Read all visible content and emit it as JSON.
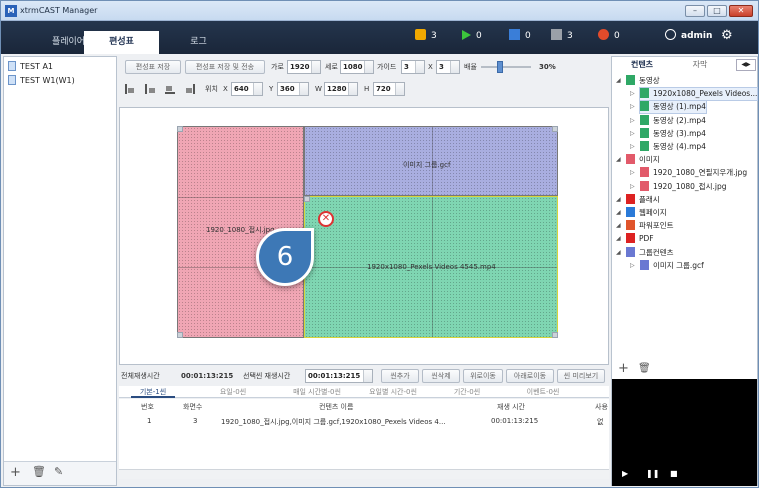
{
  "window": {
    "title": "xtrmCAST Manager",
    "logo": "M",
    "minimize": "–",
    "maximize": "□",
    "close": "✕"
  },
  "topbar": {
    "tabs": [
      {
        "label": "플레이어"
      },
      {
        "label": "편성표"
      },
      {
        "label": "로그"
      }
    ],
    "stats": [
      {
        "icon": "alert-icon",
        "value": "3",
        "color": "#f0a800"
      },
      {
        "icon": "play-icon",
        "value": "0",
        "color": "#3cc43c"
      },
      {
        "icon": "monitor-blue-icon",
        "value": "0",
        "color": "#3a7ed8"
      },
      {
        "icon": "monitor-gray-icon",
        "value": "3",
        "color": "#9aa0a8"
      },
      {
        "icon": "error-icon",
        "value": "0",
        "color": "#e24b2b"
      }
    ],
    "user": "admin",
    "user_icon": "account-icon",
    "settings_icon": "gear-icon"
  },
  "left": {
    "items": [
      {
        "label": "TEST A1"
      },
      {
        "label": "TEST W1(W1)"
      }
    ],
    "footer": {
      "add": "+",
      "delete": "🗑",
      "edit": "✎"
    }
  },
  "toolbar": {
    "save": "편성표 저장",
    "save_send": "편성표 저장 및 전송",
    "width_label": "가로",
    "width": "1920",
    "height_label": "세로",
    "height": "1080",
    "guide_label": "가이드",
    "guide_x": "3",
    "x_sep": "X",
    "guide_y": "3",
    "zoom_label": "배율",
    "zoom": "30%",
    "pos_label": "위치",
    "x_label": "X",
    "x": "640",
    "y_label": "Y",
    "y": "360",
    "w_label": "W",
    "w": "1280",
    "h_label": "H",
    "h": "720"
  },
  "canvas": {
    "zones": [
      {
        "label": "이미지 그룹.gcf"
      },
      {
        "label": "1920_1080_접시.jpg"
      },
      {
        "label": "1920x1080_Pexels Videos 4545.mp4"
      }
    ],
    "step": "6",
    "delete": "✕"
  },
  "playbar": {
    "total_label": "전체재생시간",
    "total": "00:01:13:215",
    "selected_label": "선택씬 재생시간",
    "selected": "00:01:13:215",
    "buttons": [
      "씬추가",
      "씬삭제",
      "위로이동",
      "아래로이동",
      "씬 미리보기"
    ]
  },
  "schedule_tabs": [
    "기본-1씬",
    "요일-0씬",
    "매일 시간별-0씬",
    "요일별 시간-0씬",
    "기간-0씬",
    "이벤트-0씬"
  ],
  "grid": {
    "headers": [
      "번호",
      "화면수",
      "컨텐츠 이름",
      "재생 시간",
      "사용"
    ],
    "rows": [
      {
        "no": "1",
        "screens": "3",
        "content": "1920_1080_접시.jpg,이미지 그룹.gcf,1920x1080_Pexels Videos 4...",
        "time": "00:01:13:215",
        "use": "없"
      }
    ]
  },
  "right": {
    "tabs": [
      "컨텐츠",
      "자막"
    ],
    "tree": [
      {
        "label": "동영상",
        "level": 0,
        "icon": "video-folder-icon"
      },
      {
        "label": "1920x1080_Pexels Videos...",
        "level": 1,
        "icon": "video-file-icon"
      },
      {
        "label": "동영상 (1).mp4",
        "level": 1,
        "icon": "video-file-icon"
      },
      {
        "label": "동영상 (2).mp4",
        "level": 1,
        "icon": "video-file-icon"
      },
      {
        "label": "동영상 (3).mp4",
        "level": 1,
        "icon": "video-file-icon"
      },
      {
        "label": "동영상 (4).mp4",
        "level": 1,
        "icon": "video-file-icon"
      },
      {
        "label": "이미지",
        "level": 0,
        "icon": "image-folder-icon"
      },
      {
        "label": "1920_1080_연필지우개.jpg",
        "level": 1,
        "icon": "image-file-icon"
      },
      {
        "label": "1920_1080_접시.jpg",
        "level": 1,
        "icon": "image-file-icon"
      },
      {
        "label": "플래시",
        "level": 0,
        "icon": "flash-icon"
      },
      {
        "label": "웹페이지",
        "level": 0,
        "icon": "web-icon"
      },
      {
        "label": "파워포인트",
        "level": 0,
        "icon": "powerpoint-icon"
      },
      {
        "label": "PDF",
        "level": 0,
        "icon": "pdf-icon"
      },
      {
        "label": "그룹컨텐츠",
        "level": 0,
        "icon": "group-folder-icon"
      },
      {
        "label": "이미지 그룹.gcf",
        "level": 1,
        "icon": "group-file-icon"
      }
    ],
    "footer": {
      "add": "+",
      "delete": "🗑"
    },
    "preview": {
      "play": "▶",
      "pause": "❚❚",
      "stop": "■"
    }
  }
}
